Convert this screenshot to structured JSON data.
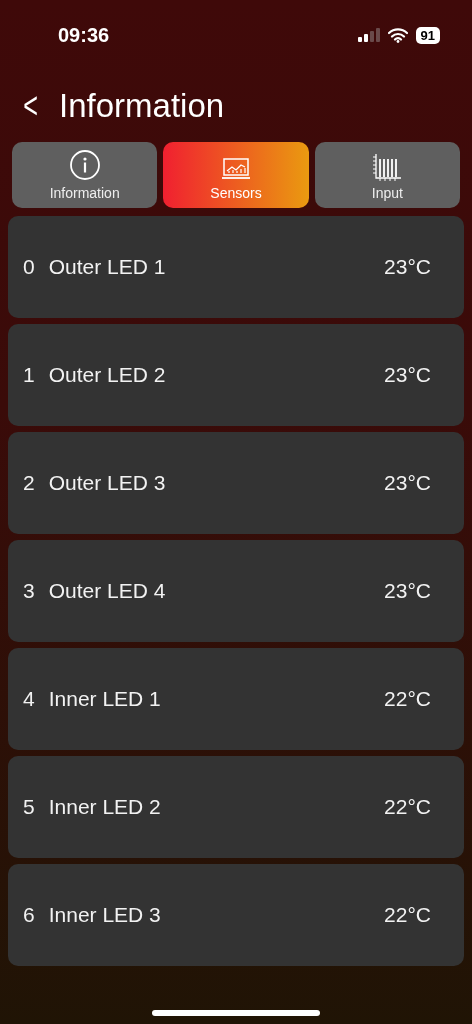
{
  "status_bar": {
    "time": "09:36",
    "battery": "91"
  },
  "header": {
    "back": "<",
    "title": "Information"
  },
  "tabs": [
    {
      "label": "Information",
      "kind": "info",
      "selected": false
    },
    {
      "label": "Sensors",
      "kind": "chart",
      "selected": true
    },
    {
      "label": "Input",
      "kind": "bars",
      "selected": false
    }
  ],
  "sensors": [
    {
      "index": "0",
      "name": "Outer LED 1",
      "value": "23°C"
    },
    {
      "index": "1",
      "name": "Outer LED 2",
      "value": "23°C"
    },
    {
      "index": "2",
      "name": "Outer LED 3",
      "value": "23°C"
    },
    {
      "index": "3",
      "name": "Outer LED 4",
      "value": "23°C"
    },
    {
      "index": "4",
      "name": "Inner LED 1",
      "value": "22°C"
    },
    {
      "index": "5",
      "name": "Inner LED 2",
      "value": "22°C"
    },
    {
      "index": "6",
      "name": "Inner LED 3",
      "value": "22°C"
    }
  ]
}
